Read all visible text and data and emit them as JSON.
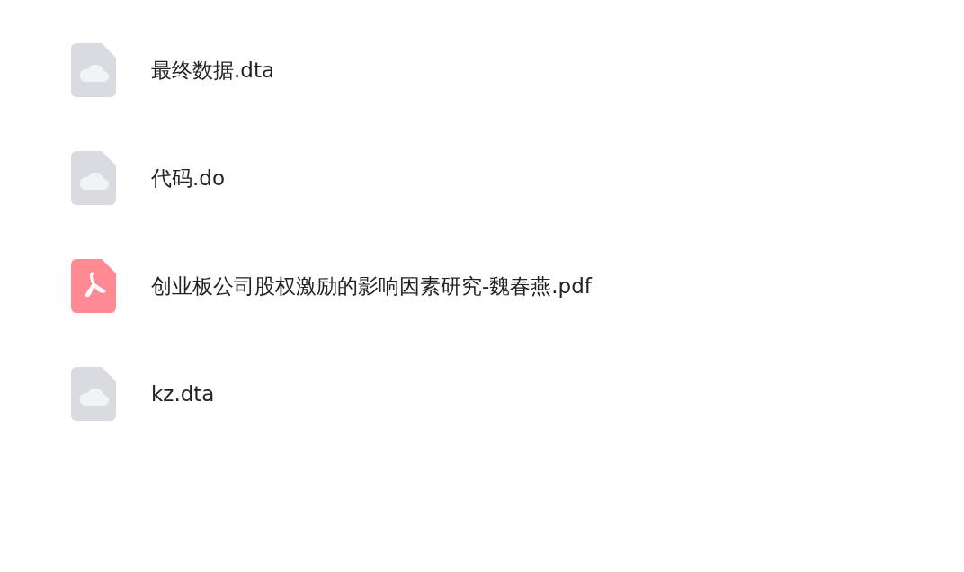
{
  "files": [
    {
      "name": "最终数据.dta",
      "kind": "generic"
    },
    {
      "name": "代码.do",
      "kind": "generic"
    },
    {
      "name": "创业板公司股权激励的影响因素研究-魏春燕.pdf",
      "kind": "pdf"
    },
    {
      "name": "kz.dta",
      "kind": "generic"
    }
  ]
}
